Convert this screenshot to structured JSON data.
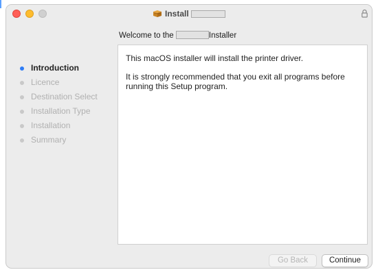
{
  "window": {
    "title": "Install",
    "title_redacted": true
  },
  "header": {
    "welcome_prefix": "Welcome to the",
    "welcome_suffix": "Installer"
  },
  "steps": [
    {
      "label": "Introduction",
      "active": true
    },
    {
      "label": "Licence",
      "active": false
    },
    {
      "label": "Destination Select",
      "active": false
    },
    {
      "label": "Installation Type",
      "active": false
    },
    {
      "label": "Installation",
      "active": false
    },
    {
      "label": "Summary",
      "active": false
    }
  ],
  "content": {
    "paragraph1": "This macOS installer will install the printer driver.",
    "paragraph2": "It is strongly recommended that you exit all programs before running this Setup program."
  },
  "buttons": {
    "back_label": "Go Back",
    "continue_label": "Continue"
  },
  "colors": {
    "active_step_dot": "#2e7cf6",
    "close": "#ff5f57",
    "minimize": "#febc2e"
  }
}
